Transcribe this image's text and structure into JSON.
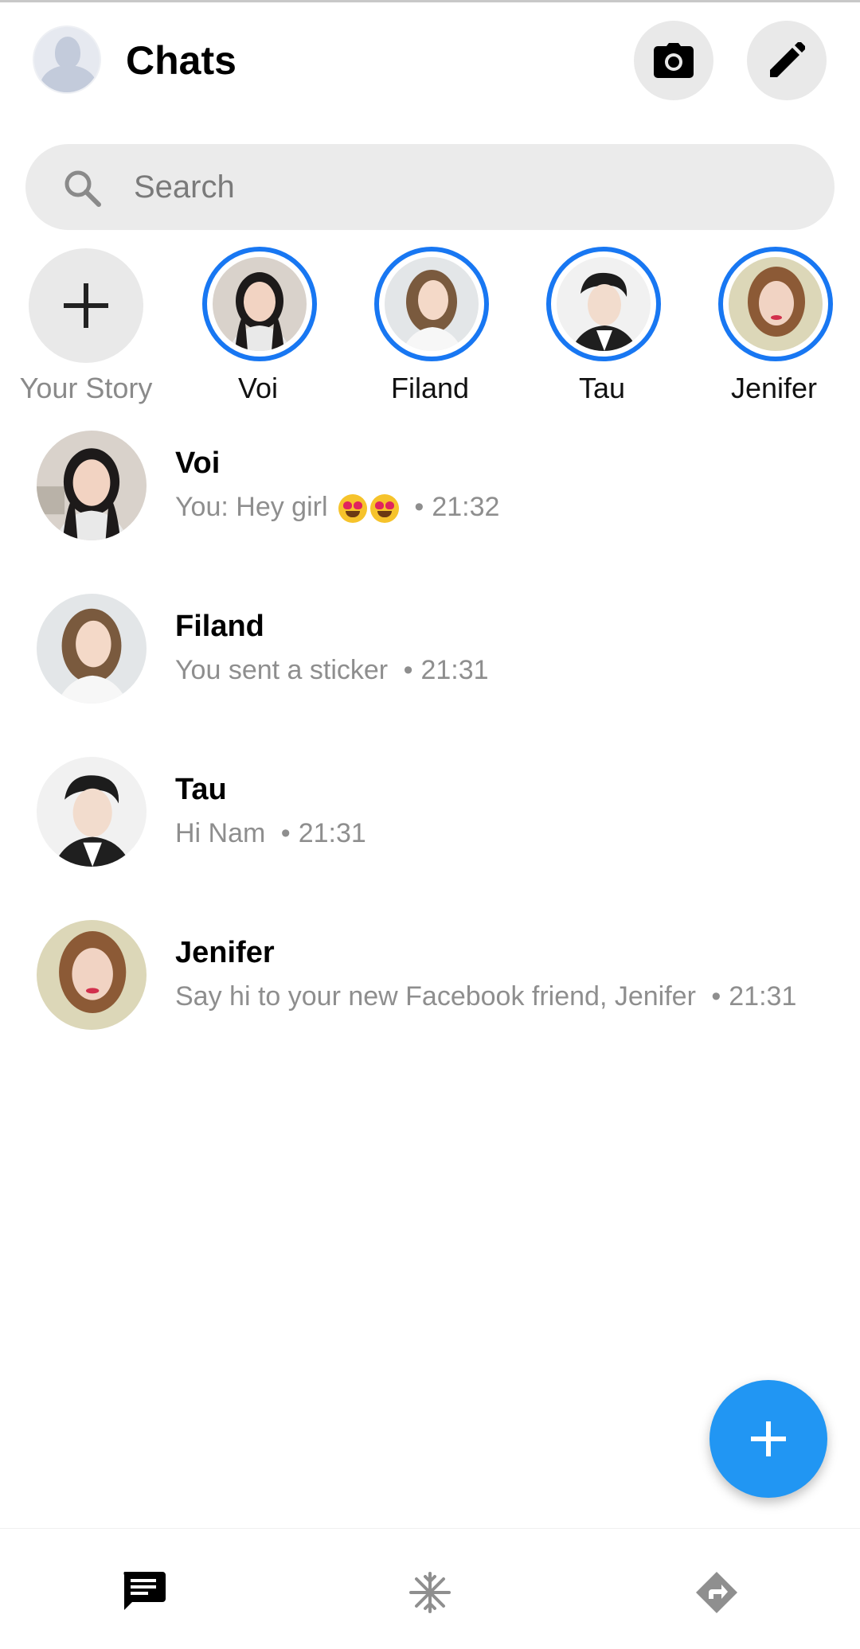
{
  "header": {
    "title": "Chats"
  },
  "search": {
    "placeholder": "Search"
  },
  "stories": [
    {
      "label": "Your Story"
    },
    {
      "label": "Voi"
    },
    {
      "label": "Filand"
    },
    {
      "label": "Tau"
    },
    {
      "label": "Jenifer"
    }
  ],
  "chats": [
    {
      "name": "Voi",
      "preview": "You: Hey girl",
      "time": "21:32",
      "dot": "•"
    },
    {
      "name": "Filand",
      "preview": "You sent a sticker",
      "time": "21:31",
      "dot": "•"
    },
    {
      "name": "Tau",
      "preview": " Hi Nam",
      "time": "21:31",
      "dot": "•"
    },
    {
      "name": "Jenifer",
      "preview": "Say hi to your new Facebook friend, Jenifer",
      "time": "21:31",
      "dot": "•"
    }
  ],
  "colors": {
    "accent": "#1877f2",
    "fab": "#2196f3"
  },
  "icons": [
    "camera-icon",
    "pencil-icon",
    "search-icon",
    "plus-icon",
    "chat-bubble-icon",
    "people-icon",
    "discover-icon"
  ]
}
